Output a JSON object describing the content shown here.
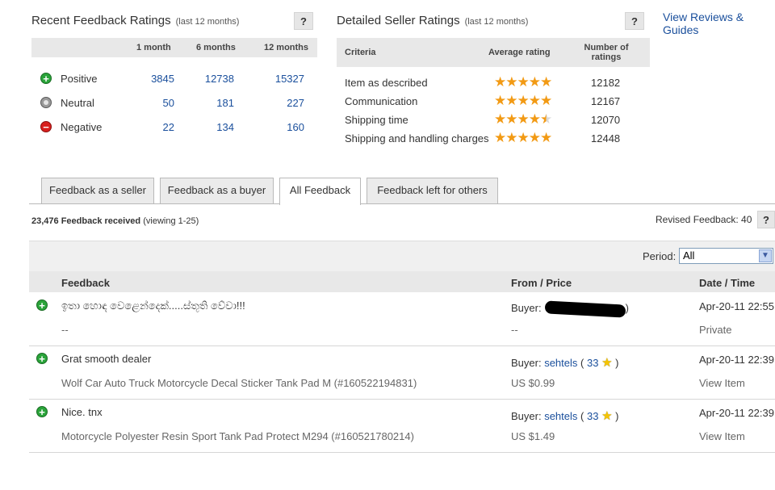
{
  "top_link": "View Reviews & Guides",
  "recent": {
    "title": "Recent Feedback Ratings",
    "subtitle": "(last 12 months)",
    "help": "?",
    "cols": [
      "1 month",
      "6 months",
      "12 months"
    ],
    "rows": [
      {
        "label": "Positive",
        "icon": "positive-icon",
        "v1": "3845",
        "v6": "12738",
        "v12": "15327"
      },
      {
        "label": "Neutral",
        "icon": "neutral-icon",
        "v1": "50",
        "v6": "181",
        "v12": "227"
      },
      {
        "label": "Negative",
        "icon": "negative-icon",
        "v1": "22",
        "v6": "134",
        "v12": "160"
      }
    ]
  },
  "detailed": {
    "title": "Detailed Seller Ratings",
    "subtitle": "(last 12 months)",
    "help": "?",
    "col_criteria": "Criteria",
    "col_avg": "Average rating",
    "col_num": "Number of ratings",
    "rows": [
      {
        "criteria": "Item as described",
        "stars": 5,
        "count": "12182"
      },
      {
        "criteria": "Communication",
        "stars": 5,
        "count": "12167"
      },
      {
        "criteria": "Shipping time",
        "stars": 4.5,
        "count": "12070"
      },
      {
        "criteria": "Shipping and handling charges",
        "stars": 5,
        "count": "12448"
      }
    ]
  },
  "tabs": [
    {
      "label": "Feedback as a seller",
      "active": false
    },
    {
      "label": "Feedback as a buyer",
      "active": false
    },
    {
      "label": "All Feedback",
      "active": true
    },
    {
      "label": "Feedback left for others",
      "active": false
    }
  ],
  "summary": {
    "count": "23,476 Feedback received",
    "viewing": "(viewing 1-25)",
    "revised": "Revised Feedback: 40",
    "help": "?"
  },
  "period": {
    "label": "Period:",
    "value": "All"
  },
  "columns": {
    "feedback": "Feedback",
    "from": "From / Price",
    "date": "Date / Time"
  },
  "feedback": [
    {
      "comment": "ඉතා හොඳ වෙළෙන්දෙක්.....ස්තූති වේවා!!!",
      "item": "--",
      "buyer_label": "Buyer:",
      "buyer": "",
      "buyer_close": ")",
      "price": "--",
      "date": "Apr-20-11 22:55",
      "action": "Private"
    },
    {
      "comment": "Grat smooth dealer",
      "item": "Wolf Car Auto Truck Motorcycle Decal Sticker Tank Pad M (#160522194831)",
      "buyer_label": "Buyer:",
      "buyer": "sehtels",
      "score": "33",
      "price": "US $0.99",
      "date": "Apr-20-11 22:39",
      "action": "View Item"
    },
    {
      "comment": "Nice. tnx",
      "item": "Motorcycle Polyester Resin Sport Tank Pad Protect M294 (#160521780214)",
      "buyer_label": "Buyer:",
      "buyer": "sehtels",
      "score": "33",
      "price": "US $1.49",
      "date": "Apr-20-11 22:39",
      "action": "View Item"
    }
  ]
}
